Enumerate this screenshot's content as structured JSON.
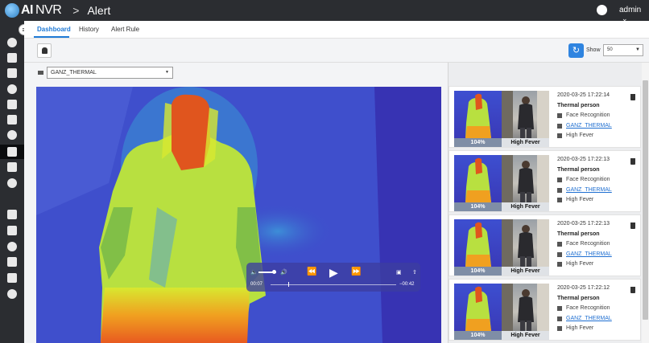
{
  "app": {
    "brand_ai": "AI",
    "brand_name": "NVR",
    "separator": ">",
    "page_title": "Alert",
    "user": "admin"
  },
  "icons": {
    "logo": "ai-nvr-logo",
    "globe": "globe-icon",
    "menu_toggle": "menu-icon",
    "bell": "bell-icon",
    "refresh": "refresh-icon",
    "camera": "camera-icon",
    "trash": "trash-icon"
  },
  "tabs": [
    {
      "label": "Dashboard",
      "active": true
    },
    {
      "label": "History",
      "active": false
    },
    {
      "label": "Alert Rule",
      "active": false
    }
  ],
  "sidebar": {
    "items": [
      {
        "icon": "search-icon"
      },
      {
        "icon": "face-scan-icon"
      },
      {
        "icon": "car-icon"
      },
      {
        "icon": "route-icon"
      },
      {
        "icon": "crowd-icon"
      },
      {
        "icon": "intrusion-icon"
      },
      {
        "icon": "info-icon"
      },
      {
        "icon": "bell-icon",
        "active": true
      },
      {
        "icon": "recognition-icon"
      },
      {
        "icon": "analytics-icon"
      },
      {
        "icon": "tools-icon"
      },
      {
        "icon": "document-icon"
      },
      {
        "icon": "video-camera-icon"
      },
      {
        "icon": "recorder-icon"
      },
      {
        "icon": "user-icon"
      },
      {
        "icon": "settings-icon"
      }
    ]
  },
  "toolbar": {
    "show_label": "Show",
    "show_value": "50"
  },
  "camera": {
    "selected": "GANZ_THERMAL"
  },
  "player": {
    "time_elapsed": "00:07",
    "time_remaining": "−00:42",
    "progress": 0.14,
    "volume": 0.85
  },
  "alerts": [
    {
      "time": "2020-03-25 17:22:14",
      "title": "Thermal person",
      "source": "Face Recognition",
      "camera": "GANZ_THERMAL",
      "tag": "High Fever",
      "temp_label": "104%",
      "status_label": "High Fever"
    },
    {
      "time": "2020-03-25 17:22:13",
      "title": "Thermal person",
      "source": "Face Recognition",
      "camera": "GANZ_THERMAL",
      "tag": "High Fever",
      "temp_label": "104%",
      "status_label": "High Fever"
    },
    {
      "time": "2020-03-25 17:22:13",
      "title": "Thermal person",
      "source": "Face Recognition",
      "camera": "GANZ_THERMAL",
      "tag": "High Fever",
      "temp_label": "104%",
      "status_label": "High Fever"
    },
    {
      "time": "2020-03-25 17:22:12",
      "title": "Thermal person",
      "source": "Face Recognition",
      "camera": "GANZ_THERMAL",
      "tag": "High Fever",
      "temp_label": "104%",
      "status_label": "High Fever"
    }
  ]
}
